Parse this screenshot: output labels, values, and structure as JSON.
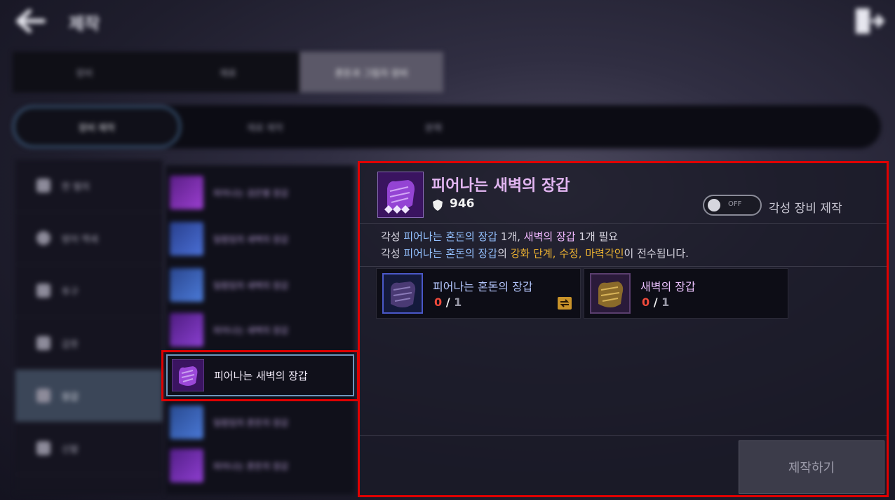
{
  "header": {
    "title": "제작"
  },
  "top_tabs": [
    {
      "label": "장비"
    },
    {
      "label": "재료"
    },
    {
      "label": "혼돈과 그림자 장비"
    }
  ],
  "sub_tabs": [
    {
      "label": "장비 제작"
    },
    {
      "label": "재료 제작"
    },
    {
      "label": "분해"
    }
  ],
  "categories": [
    {
      "label": "한 벌의",
      "icon": "helmet-icon"
    },
    {
      "label": "방어 액세",
      "icon": "ring-icon"
    },
    {
      "label": "투구",
      "icon": "helmet-icon"
    },
    {
      "label": "갑옷",
      "icon": "armor-icon"
    },
    {
      "label": "장갑",
      "icon": "glove-icon"
    },
    {
      "label": "신발",
      "icon": "boot-icon"
    }
  ],
  "item_list": [
    {
      "label": "피어나는 검은별 장갑",
      "color": "#9b3fd0"
    },
    {
      "label": "일렁임의 새벽의 장갑",
      "color": "#4a6fd6"
    },
    {
      "label": "일렁임의 새벽의 장갑",
      "color": "#4b7ad8"
    },
    {
      "label": "피어나는 새벽의 장갑",
      "color": "#8a3fd0"
    },
    {
      "label": "피어나는 새벽의 장갑",
      "color": "#7a36c8"
    },
    {
      "label": "일렁임의 혼돈의 장갑",
      "color": "#4a78d6"
    },
    {
      "label": "피어나는 혼돈의 장갑",
      "color": "#8e3ed0"
    }
  ],
  "selected_item": {
    "list_label": "피어나는 새벽의 장갑",
    "name": "피어나는 새벽의 장갑",
    "power": "946",
    "awaken_toggle": "OFF",
    "awaken_label": "각성 장비 제작",
    "desc_line1": {
      "prefix": "각성 ",
      "item_a": "피어나는 혼돈의 장갑",
      "mid": " 1개, ",
      "item_b": "새벽의 장갑",
      "suffix": " 1개 필요"
    },
    "desc_line2": {
      "prefix": "각성 ",
      "item_a": "피어나는 혼돈의 장갑",
      "mid": "의 ",
      "gold": "강화 단계, 수정, 마력각인",
      "suffix": "이 전수됩니다."
    },
    "materials": [
      {
        "name": "피어나는 혼돈의 장갑",
        "have": "0",
        "sep": "/",
        "need": "1",
        "name_color": "#b6c8ff"
      },
      {
        "name": "새벽의 장갑",
        "have": "0",
        "sep": "/",
        "need": "1",
        "name_color": "#ecc2ff"
      }
    ],
    "craft_button": "제작하기"
  }
}
